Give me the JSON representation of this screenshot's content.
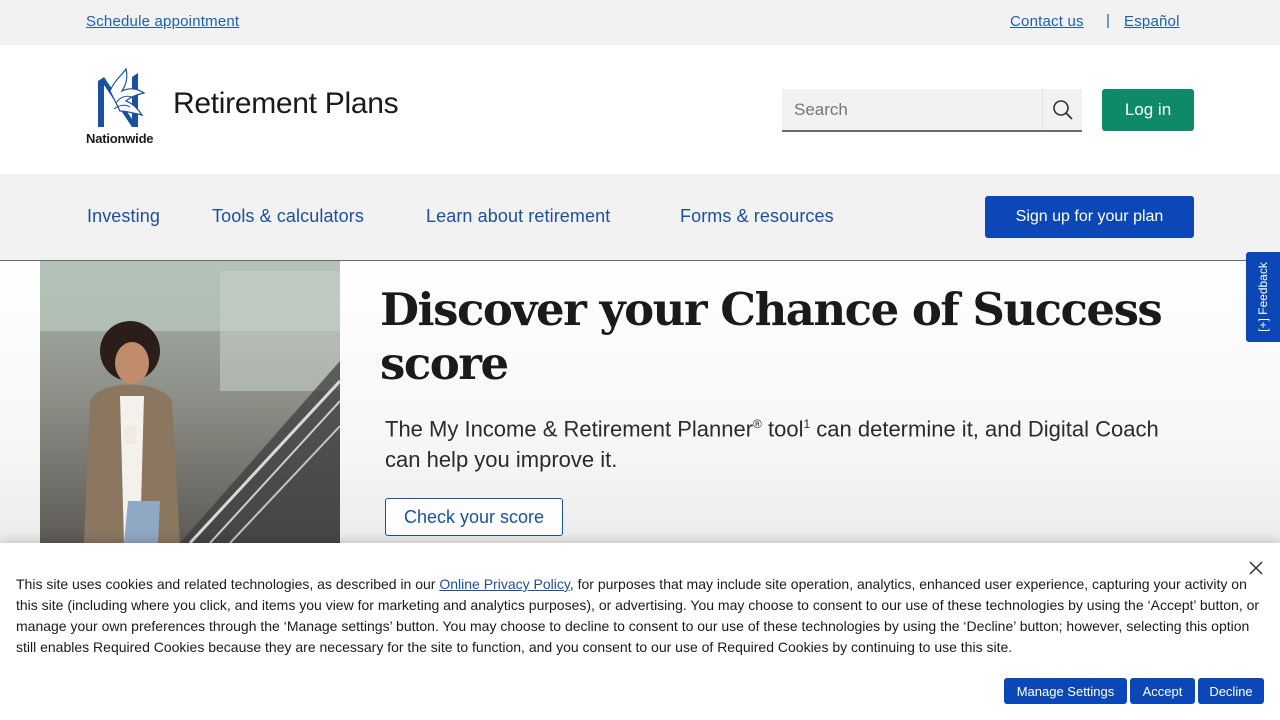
{
  "utility": {
    "schedule": "Schedule appointment",
    "contact": "Contact us",
    "separator": "|",
    "espanol": "Español"
  },
  "header": {
    "logo_word": "Nationwide",
    "title": "Retirement Plans",
    "search_placeholder": "Search",
    "login": "Log in"
  },
  "nav": {
    "items": [
      "Investing",
      "Tools & calculators",
      "Learn about retirement",
      "Forms & resources"
    ],
    "signup": "Sign up for your plan"
  },
  "hero": {
    "title": "Discover your Chance of Success score",
    "body_part1": "The My Income & Retirement Planner",
    "body_reg": "®",
    "body_part2": " tool",
    "body_sup": "1",
    "body_part3": " can determine it, and Digital Coach can help you improve it.",
    "cta": "Check your score"
  },
  "feedback": {
    "label": "[+] Feedback"
  },
  "cookie": {
    "text_before": "This site uses cookies and related technologies, as described in our ",
    "link": "Online Privacy Policy",
    "text_after": ", for purposes that may include site operation, analytics, enhanced user experience, capturing your activity on this site (including where you click, and items you view for marketing and analytics purposes), or advertising. You may choose to consent to our use of these technologies by using the ‘Accept’ button, or manage your own preferences through the ‘Manage settings’ button. You may choose to decline to consent to our use of these technologies by using the ‘Decline’ button; however, selecting this option still enables Required Cookies because they are necessary for the site to function, and you consent to our use of Required Cookies by continuing to use this site.",
    "manage": "Manage Settings",
    "accept": "Accept",
    "decline": "Decline"
  },
  "colors": {
    "brand_blue": "#0b47b6",
    "link_blue": "#1b4fa0",
    "login_green": "#0e8a6a"
  },
  "icons": [
    "nationwide-eagle-logo-icon",
    "search-icon",
    "close-icon"
  ]
}
